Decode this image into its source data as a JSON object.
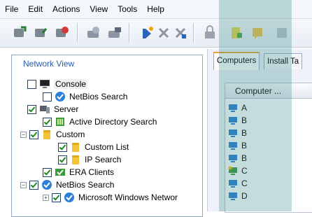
{
  "menu": [
    "File",
    "Edit",
    "Actions",
    "View",
    "Tools",
    "Help"
  ],
  "network_view": {
    "title": "Network View",
    "items": [
      {
        "label": "Console",
        "checked": false,
        "icon": "monitor-icon"
      },
      {
        "label": "NetBios Search",
        "checked": false,
        "icon": "netbios-icon"
      },
      {
        "label": "Server",
        "checked": true,
        "icon": "server-icon"
      },
      {
        "label": "Active Directory Search",
        "checked": true,
        "icon": "active-directory-icon"
      },
      {
        "label": "Custom",
        "checked": true,
        "icon": "folder-icon"
      },
      {
        "label": "Custom List",
        "checked": true,
        "icon": "folder-icon"
      },
      {
        "label": "IP Search",
        "checked": true,
        "icon": "folder-icon"
      },
      {
        "label": "ERA Clients",
        "checked": true,
        "icon": "era-clients-icon"
      },
      {
        "label": "NetBios Search",
        "checked": true,
        "icon": "netbios-icon"
      },
      {
        "label": "Microsoft Windows Networ",
        "checked": true,
        "icon": "netbios-icon"
      }
    ]
  },
  "tabs": [
    "Computers",
    "Install Ta"
  ],
  "computers_table": {
    "column_header": "Computer ...",
    "rows": [
      "A",
      "B",
      "B",
      "B",
      "B",
      "C",
      "C",
      "D"
    ]
  },
  "colors": {
    "accent": "#2a5db0",
    "overlay": "#3c8c8c",
    "tab_highlight": "#f0a030"
  }
}
